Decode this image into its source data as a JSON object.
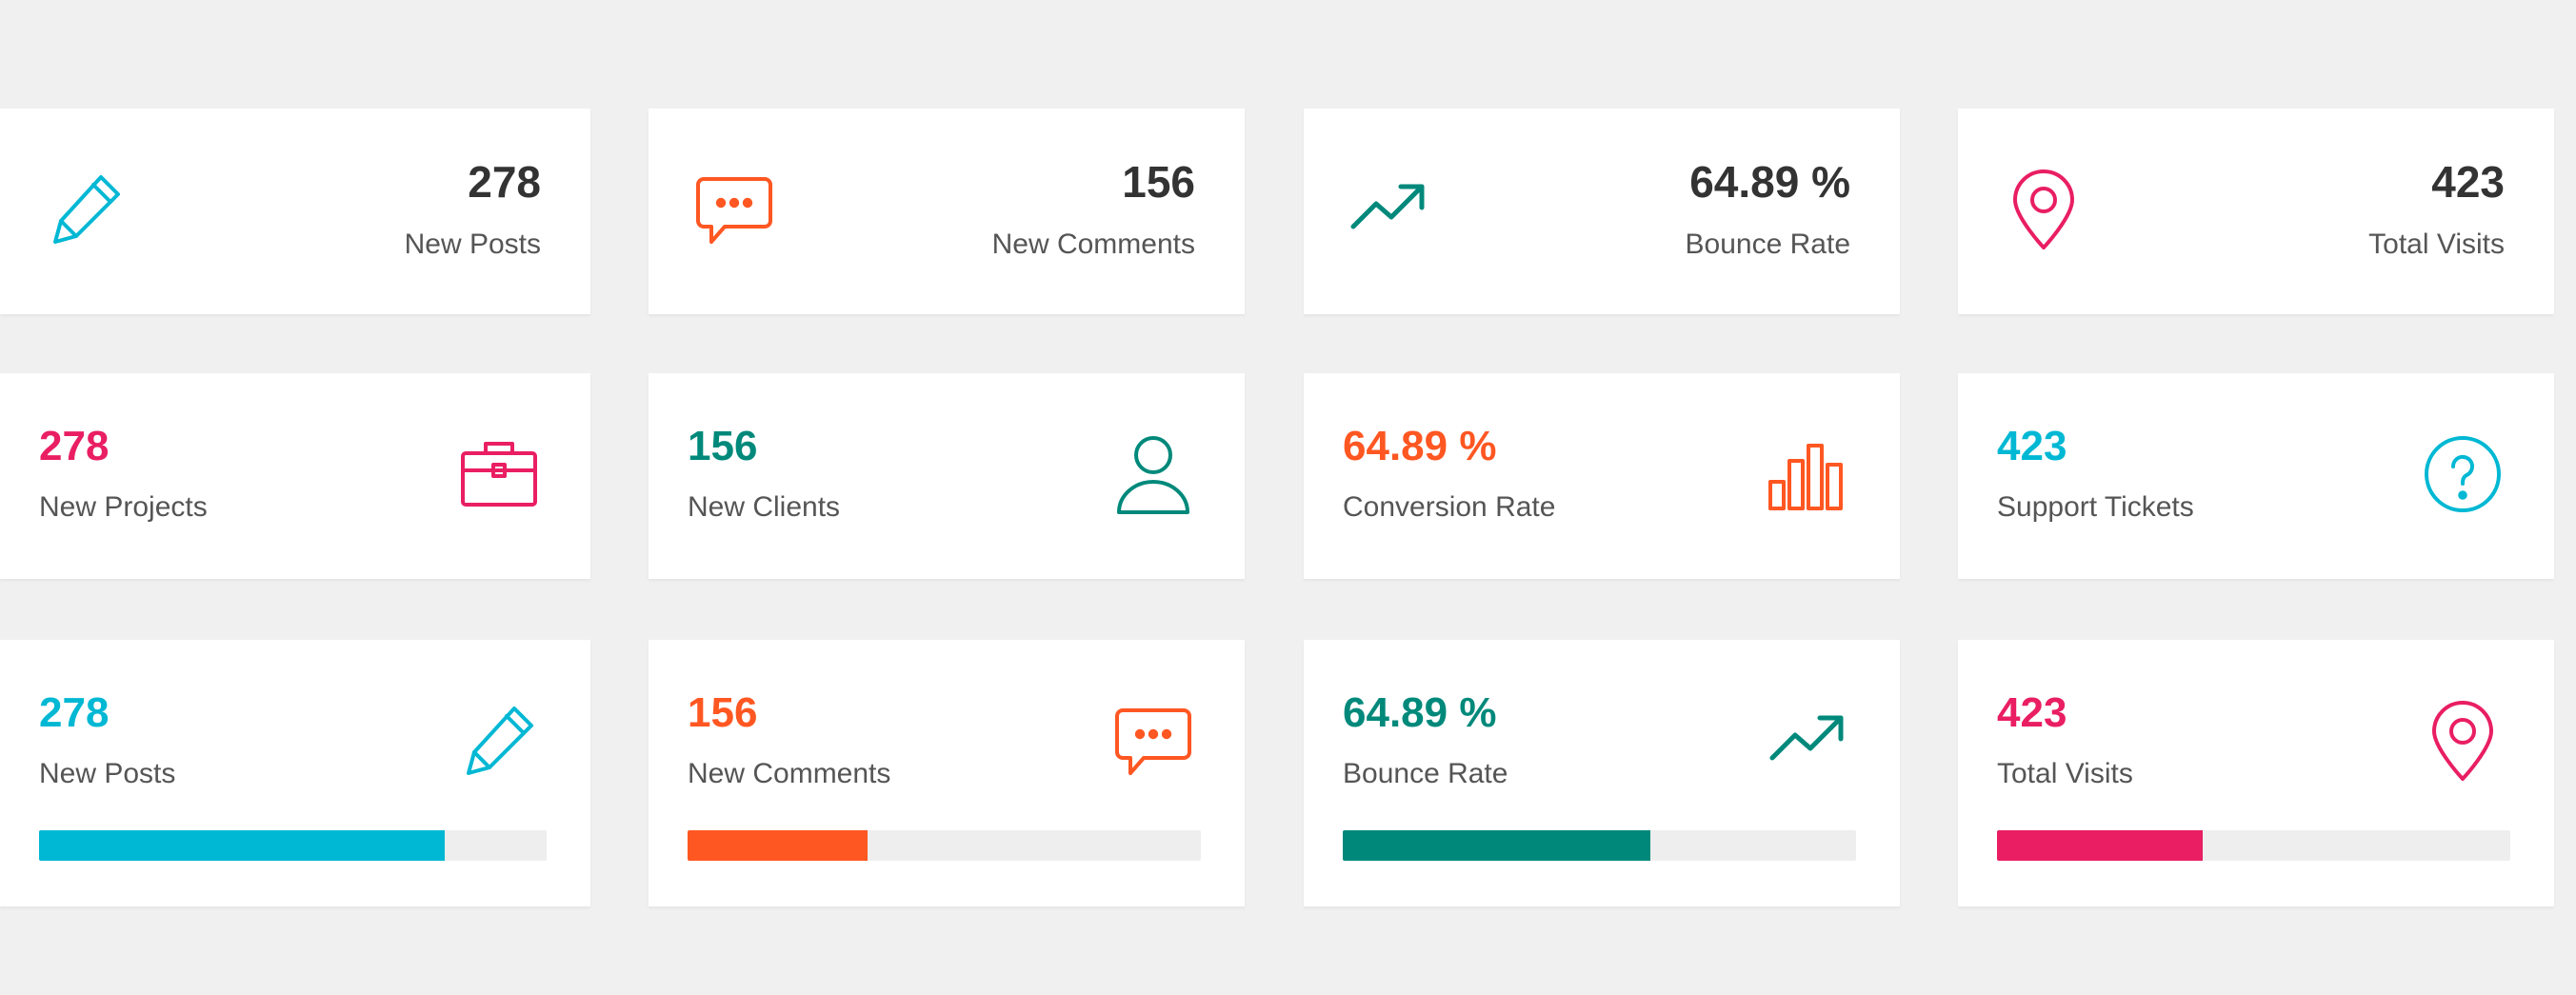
{
  "colors": {
    "background": "#f0f0f0",
    "card": "#ffffff",
    "dark_text": "#333333",
    "muted_text": "#555555",
    "blue": "#00b8d4",
    "orange": "#ff5722",
    "teal": "#00897b",
    "pink": "#e91e63",
    "track": "#eeeeee"
  },
  "row1": [
    {
      "value": "278",
      "label": "New Posts",
      "icon": "pencil-icon",
      "color": "#00b8d4"
    },
    {
      "value": "156",
      "label": "New Comments",
      "icon": "comment-icon",
      "color": "#ff5722"
    },
    {
      "value": "64.89 %",
      "label": "Bounce Rate",
      "icon": "trend-up-icon",
      "color": "#00897b"
    },
    {
      "value": "423",
      "label": "Total Visits",
      "icon": "map-pin-icon",
      "color": "#e91e63"
    }
  ],
  "row2": [
    {
      "value": "278",
      "label": "New Projects",
      "icon": "briefcase-icon",
      "color": "#e91e63"
    },
    {
      "value": "156",
      "label": "New Clients",
      "icon": "user-icon",
      "color": "#00897b"
    },
    {
      "value": "64.89 %",
      "label": "Conversion Rate",
      "icon": "bar-chart-icon",
      "color": "#ff5722"
    },
    {
      "value": "423",
      "label": "Support Tickets",
      "icon": "question-circle-icon",
      "color": "#00b8d4"
    }
  ],
  "row3": [
    {
      "value": "278",
      "label": "New Posts",
      "icon": "pencil-icon",
      "color": "#00b8d4",
      "progress_percent": 80
    },
    {
      "value": "156",
      "label": "New Comments",
      "icon": "comment-icon",
      "color": "#ff5722",
      "progress_percent": 35
    },
    {
      "value": "64.89 %",
      "label": "Bounce Rate",
      "icon": "trend-up-icon",
      "color": "#00897b",
      "progress_percent": 60
    },
    {
      "value": "423",
      "label": "Total Visits",
      "icon": "map-pin-icon",
      "color": "#e91e63",
      "progress_percent": 40
    }
  ]
}
